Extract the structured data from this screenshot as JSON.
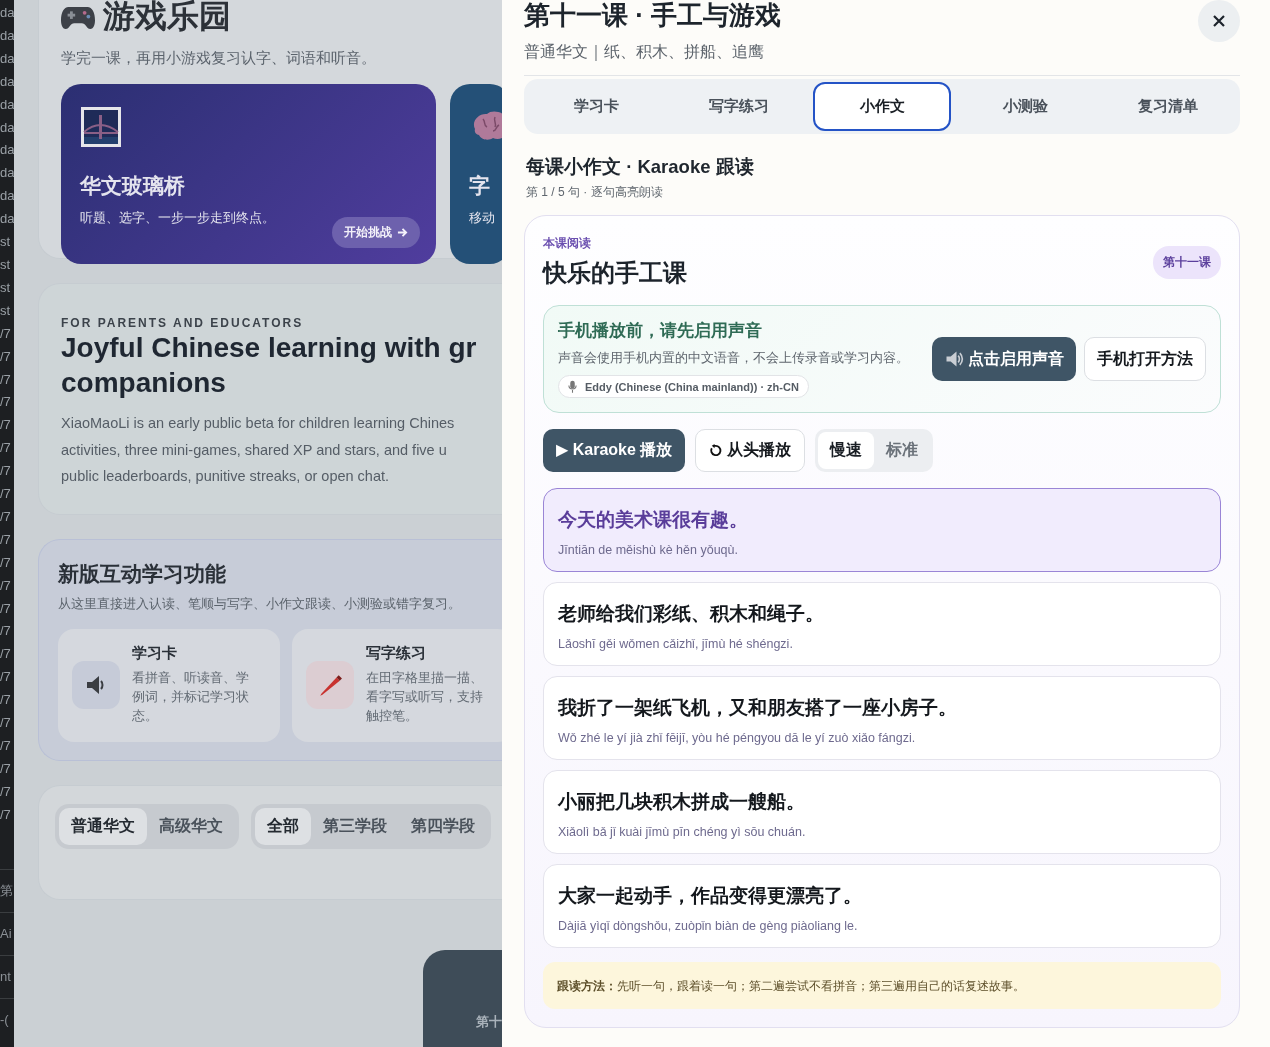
{
  "terminal_strip": {
    "lines": [
      "da",
      "da",
      "da",
      "da",
      "da",
      "da",
      "da",
      "da",
      "da",
      "da",
      "st",
      "st",
      "st",
      "st",
      "/7",
      "/7",
      "/7",
      "/7",
      "/7",
      "/7",
      "/7",
      "/7",
      "/7",
      "/7",
      "/7",
      "/7",
      "/7",
      "/7",
      "/7",
      "/7",
      "/7",
      "/7",
      "/7",
      "/7",
      "/7",
      "/7"
    ],
    "rows": [
      "第",
      "Ai",
      "nt",
      "-("
    ]
  },
  "background_page": {
    "games": {
      "title": "游戏乐园",
      "subtitle": "学完一课，再用小游戏复习认字、词语和听音。",
      "cards": [
        {
          "kind": "bridge",
          "title": "华文玻璃桥",
          "description": "听题、选字、一步一步走到终点。",
          "button": "开始挑战"
        },
        {
          "kind": "brain",
          "title": "字",
          "description": "移动"
        }
      ]
    },
    "intro": {
      "eyebrow": "FOR PARENTS AND EDUCATORS",
      "title_lines": [
        "Joyful Chinese learning with gr",
        "companions"
      ],
      "body_lines": [
        "XiaoMaoLi is an early public beta for children learning Chines",
        "activities, three mini-games, shared XP and stars, and five u",
        "public leaderboards, punitive streaks, or open chat."
      ]
    },
    "features": {
      "title": "新版互动学习功能",
      "subtitle": "从这里直接进入认读、笔顺与写字、小作文跟读、小测验或错字复习。",
      "cards": [
        {
          "kind": "speaker",
          "title": "学习卡",
          "description": "看拼音、听读音、学例词，并标记学习状态。"
        },
        {
          "kind": "crayon",
          "title": "写字练习",
          "description": "在田字格里描一描、看字写或听写，支持触控笔。"
        }
      ]
    },
    "filters": [
      {
        "options": [
          {
            "label": "普通华文",
            "selected": true
          },
          {
            "label": "高级华文",
            "selected": false
          }
        ]
      },
      {
        "options": [
          {
            "label": "全部",
            "selected": true
          },
          {
            "label": "第三学段",
            "selected": false
          },
          {
            "label": "第四学段",
            "selected": false
          }
        ]
      }
    ],
    "floating_button": {
      "label": "第十"
    }
  },
  "drawer": {
    "title": "第十一课 · 手工与游戏",
    "subtitle": "普通华文｜纸、积木、拼船、追鹰",
    "tabs": [
      {
        "label": "学习卡",
        "selected": false
      },
      {
        "label": "写字练习",
        "selected": false
      },
      {
        "label": "小作文",
        "selected": true
      },
      {
        "label": "小测验",
        "selected": false
      },
      {
        "label": "复习清单",
        "selected": false
      }
    ],
    "section": {
      "title": "每课小作文 · Karaoke 跟读",
      "subtitle": "第 1 / 5 句 · 逐句高亮朗读"
    },
    "reading": {
      "eyebrow": "本课阅读",
      "title": "快乐的手工课",
      "badge": "第十一课",
      "sound_notice": {
        "title": "手机播放前，请先启用声音",
        "description": "声音会使用手机内置的中文语音，不会上传录音或学习内容。",
        "voice": "Eddy (Chinese (China mainland)) · zh-CN",
        "enable_button": "点击启用声音",
        "help_button": "手机打开方法"
      },
      "controls": {
        "play_button": "▶ Karaoke 播放",
        "restart_button": "从头播放",
        "speeds": [
          {
            "label": "慢速",
            "selected": true
          },
          {
            "label": "标准",
            "selected": false
          }
        ]
      },
      "sentences": [
        {
          "hanzi": "今天的美术课很有趣。",
          "pinyin": "Jīntiān de měishù kè hěn yǒuqù.",
          "selected": true
        },
        {
          "hanzi": "老师给我们彩纸、积木和绳子。",
          "pinyin": "Lǎoshī gěi wǒmen cǎizhǐ, jīmù hé shéngzi.",
          "selected": false
        },
        {
          "hanzi": "我折了一架纸飞机，又和朋友搭了一座小房子。",
          "pinyin": "Wǒ zhé le yí jià zhǐ fēijī, yòu hé péngyou dā le yí zuò xiǎo fángzi.",
          "selected": false
        },
        {
          "hanzi": "小丽把几块积木拼成一艘船。",
          "pinyin": "Xiǎolì bǎ jǐ kuài jīmù pīn chéng yì sōu chuán.",
          "selected": false
        },
        {
          "hanzi": "大家一起动手，作品变得更漂亮了。",
          "pinyin": "Dàjiā yìqǐ dòngshǒu, zuòpǐn biàn de gèng piàoliang le.",
          "selected": false
        }
      ],
      "tip": "**跟读方法：**先听一句，跟着读一句；第二遍尝试不看拼音；第三遍用自己的话复述故事。"
    }
  }
}
